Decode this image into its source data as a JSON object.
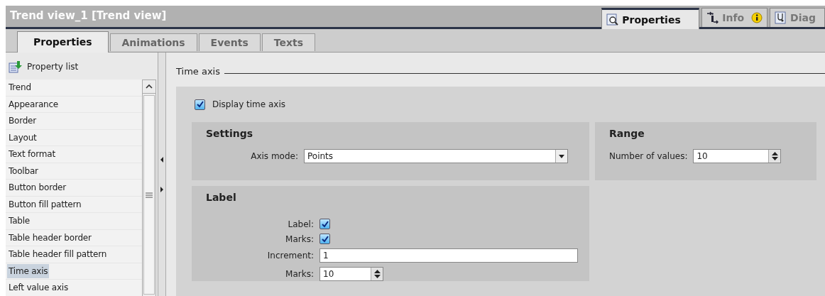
{
  "window": {
    "title": "Trend view_1 [Trend view]"
  },
  "inspector_tabs": [
    {
      "label": "Properties",
      "selected": true
    },
    {
      "label": "Info",
      "badge": true,
      "selected": false
    },
    {
      "label": "Diag",
      "selected": false
    }
  ],
  "tabs": [
    {
      "label": "Properties",
      "selected": true
    },
    {
      "label": "Animations",
      "selected": false
    },
    {
      "label": "Events",
      "selected": false
    },
    {
      "label": "Texts",
      "selected": false
    }
  ],
  "sidebar": {
    "header": "Property list",
    "items": [
      {
        "label": "Trend",
        "selected": false
      },
      {
        "label": "Appearance",
        "selected": false
      },
      {
        "label": "Border",
        "selected": false
      },
      {
        "label": "Layout",
        "selected": false
      },
      {
        "label": "Text format",
        "selected": false
      },
      {
        "label": "Toolbar",
        "selected": false
      },
      {
        "label": "Button border",
        "selected": false
      },
      {
        "label": "Button fill pattern",
        "selected": false
      },
      {
        "label": "Table",
        "selected": false
      },
      {
        "label": "Table header border",
        "selected": false
      },
      {
        "label": "Table header fill pattern",
        "selected": false
      },
      {
        "label": "Time axis",
        "selected": true
      },
      {
        "label": "Left value axis",
        "selected": false
      }
    ]
  },
  "section": {
    "title": "Time axis",
    "display": {
      "label": "Display time axis",
      "checked": true
    },
    "settings": {
      "title": "Settings",
      "fields": [
        {
          "kind": "dropdown",
          "label": "Axis mode:",
          "value": "Points"
        }
      ]
    },
    "range": {
      "title": "Range",
      "fields": [
        {
          "kind": "spinner",
          "label": "Number of values:",
          "value": "10"
        }
      ]
    },
    "label_group": {
      "title": "Label",
      "fields": [
        {
          "kind": "checkbox",
          "label": "Label:",
          "checked": true
        },
        {
          "kind": "checkbox",
          "label": "Marks:",
          "checked": true
        },
        {
          "kind": "text",
          "label": "Increment:",
          "value": "1"
        },
        {
          "kind": "spinner",
          "label": "Marks:",
          "value": "10"
        }
      ]
    }
  }
}
